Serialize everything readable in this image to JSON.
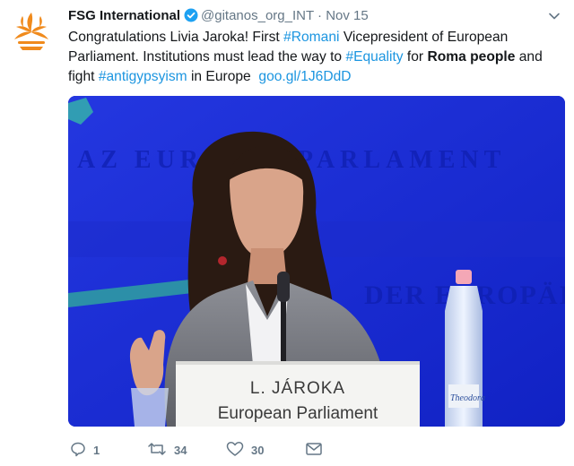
{
  "tweet": {
    "display_name": "FSG International",
    "handle": "@gitanos_org_INT",
    "separator": "·",
    "date": "Nov 15",
    "text": {
      "part1": "Congratulations Livia Jaroka! First ",
      "hashtag1": "#Romani",
      "part2": " Vicepresident of European Parliament. Institutions must lead the way to ",
      "hashtag2": "#Equality",
      "part3": " for ",
      "bold": "Roma people",
      "part4": " and fight ",
      "hashtag3": "#antigypsyism",
      "part5": " in Europe  ",
      "link": "goo.gl/1J6DdD"
    },
    "media": {
      "background_text_1": "AZ EURÓPAI PARLAMENT",
      "background_text_2": "DER EUROPÄISCHE",
      "nameplate_line1": "L. JÁROKA",
      "nameplate_line2": "European Parliament",
      "bottle_label": "Theodora"
    },
    "actions": {
      "reply_count": "1",
      "retweet_count": "34",
      "like_count": "30"
    }
  },
  "colors": {
    "link": "#1b95e0",
    "verified": "#1da1f2",
    "muted": "#657786",
    "logo_orange": "#f08a1c",
    "media_blue": "#1a2bd6"
  },
  "icons": {
    "logo": "fsg-flame-logo",
    "verified": "verified-badge-icon",
    "caret": "chevron-down-icon",
    "reply": "reply-icon",
    "retweet": "retweet-icon",
    "like": "heart-icon",
    "dm": "envelope-icon"
  }
}
